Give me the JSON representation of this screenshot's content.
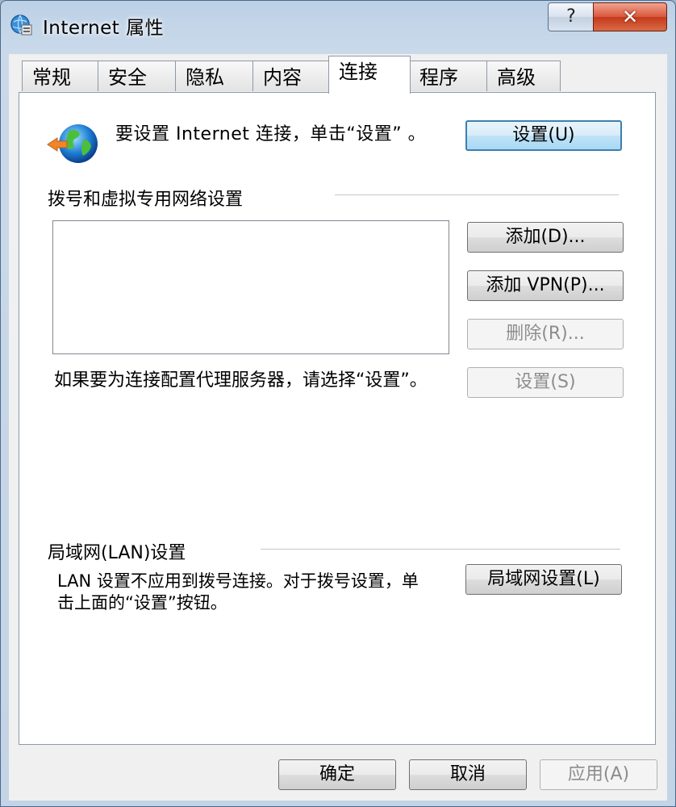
{
  "window": {
    "title": "Internet 属性",
    "help_label": "?",
    "close_label": "✕"
  },
  "tabs": [
    {
      "label": "常规"
    },
    {
      "label": "安全"
    },
    {
      "label": "隐私"
    },
    {
      "label": "内容"
    },
    {
      "label": "连接",
      "active": true
    },
    {
      "label": "程序"
    },
    {
      "label": "高级"
    }
  ],
  "setup": {
    "icon": "globe-arrow-icon",
    "text": "要设置 Internet 连接，单击“设置” 。",
    "button": "设置(U)"
  },
  "dialup": {
    "group_label": "拨号和虚拟专用网络设置",
    "add_button": "添加(D)...",
    "add_vpn_button": "添加 VPN(P)...",
    "remove_button": "删除(R)...",
    "settings_button": "设置(S)",
    "proxy_text": "如果要为连接配置代理服务器，请选择“设置”。"
  },
  "lan": {
    "group_label": "局域网(LAN)设置",
    "text": "LAN 设置不应用到拨号连接。对于拨号设置，单击上面的“设置”按钮。",
    "button": "局域网设置(L)"
  },
  "footer": {
    "ok": "确定",
    "cancel": "取消",
    "apply": "应用(A)"
  }
}
